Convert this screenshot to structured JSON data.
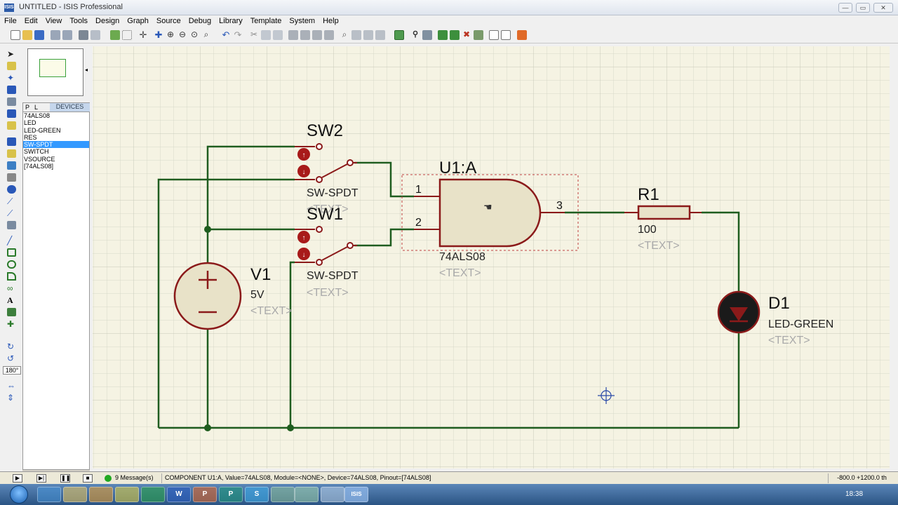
{
  "window": {
    "title": "UNTITLED - ISIS Professional",
    "app_badge": "ISIS"
  },
  "menu": [
    "File",
    "Edit",
    "View",
    "Tools",
    "Design",
    "Graph",
    "Source",
    "Debug",
    "Library",
    "Template",
    "System",
    "Help"
  ],
  "device_panel": {
    "tab_p": "P",
    "tab_l": "L",
    "header": "DEVICES",
    "items": [
      "74ALS08",
      "LED",
      "LED-GREEN",
      "RES",
      "SW-SPDT",
      "SWITCH",
      "VSOURCE",
      "[74ALS08]"
    ],
    "selected": "SW-SPDT"
  },
  "left_tools": {
    "rotation": "180°"
  },
  "schematic": {
    "sw2": {
      "ref": "SW2",
      "type": "SW-SPDT",
      "text": "<TEXT>"
    },
    "sw1": {
      "ref": "SW1",
      "type": "SW-SPDT",
      "text": "<TEXT>"
    },
    "u1": {
      "ref": "U1:A",
      "part": "74ALS08",
      "text": "<TEXT>",
      "pin1": "1",
      "pin2": "2",
      "pin3": "3"
    },
    "r1": {
      "ref": "R1",
      "value": "100",
      "text": "<TEXT>"
    },
    "d1": {
      "ref": "D1",
      "type": "LED-GREEN",
      "text": "<TEXT>"
    },
    "v1": {
      "ref": "V1",
      "value": "5V",
      "text": "<TEXT>"
    }
  },
  "status": {
    "messages": "9 Message(s)",
    "component": "COMPONENT U1:A, Value=74ALS08, Module=<NONE>, Device=74ALS08, Pinout=[74ALS08]",
    "coords": "-800.0   +1200.0  th"
  },
  "taskbar": {
    "time": "18:38",
    "apps": [
      "W",
      "P",
      "S",
      "ISIS"
    ]
  },
  "colors": {
    "wire": "#1f5d1f",
    "component_outline": "#8b1a1a",
    "component_fill": "#e8e2c8",
    "sheet": "#f5f3e3",
    "grid": "#d6d8c8"
  }
}
